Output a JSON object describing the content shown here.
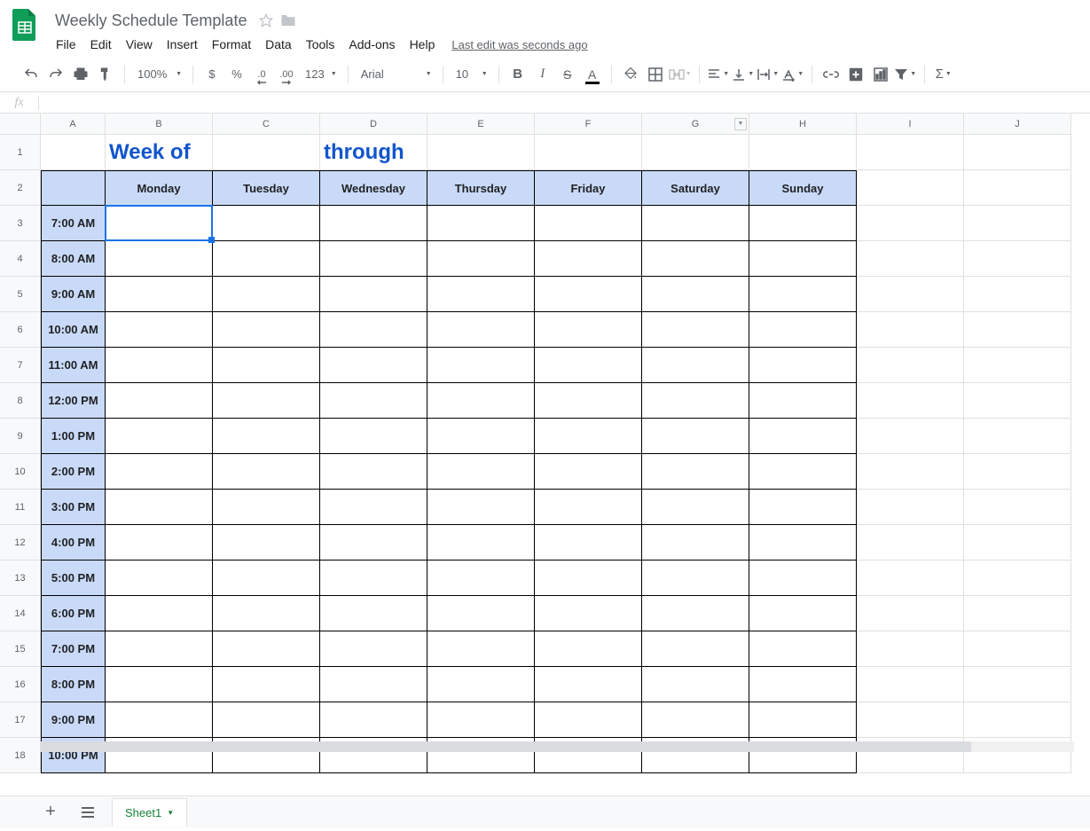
{
  "doc": {
    "title": "Weekly Schedule Template",
    "last_edit": "Last edit was seconds ago"
  },
  "menu": {
    "items": [
      "File",
      "Edit",
      "View",
      "Insert",
      "Format",
      "Data",
      "Tools",
      "Add-ons",
      "Help"
    ]
  },
  "toolbar": {
    "zoom": "100%",
    "currency": "$",
    "percent": "%",
    "dec_dec": ".0",
    "dec_inc": ".00",
    "more_formats": "123",
    "font": "Arial",
    "font_size": "10"
  },
  "formula_bar": {
    "fx_label": "fx",
    "value": ""
  },
  "columns": [
    "A",
    "B",
    "C",
    "D",
    "E",
    "F",
    "G",
    "H",
    "I",
    "J"
  ],
  "rows": [
    "1",
    "2",
    "3",
    "4",
    "5",
    "6",
    "7",
    "8",
    "9",
    "10",
    "11",
    "12",
    "13",
    "14",
    "15",
    "16",
    "17",
    "18"
  ],
  "schedule": {
    "title_b1": "Week of",
    "title_d1": "through",
    "days": [
      "Monday",
      "Tuesday",
      "Wednesday",
      "Thursday",
      "Friday",
      "Saturday",
      "Sunday"
    ],
    "times": [
      "7:00 AM",
      "8:00 AM",
      "9:00 AM",
      "10:00 AM",
      "11:00 AM",
      "12:00 PM",
      "1:00 PM",
      "2:00 PM",
      "3:00 PM",
      "4:00 PM",
      "5:00 PM",
      "6:00 PM",
      "7:00 PM",
      "8:00 PM",
      "9:00 PM",
      "10:00 PM"
    ]
  },
  "tabs": {
    "sheet1": "Sheet1"
  },
  "active_col_dd": "G"
}
